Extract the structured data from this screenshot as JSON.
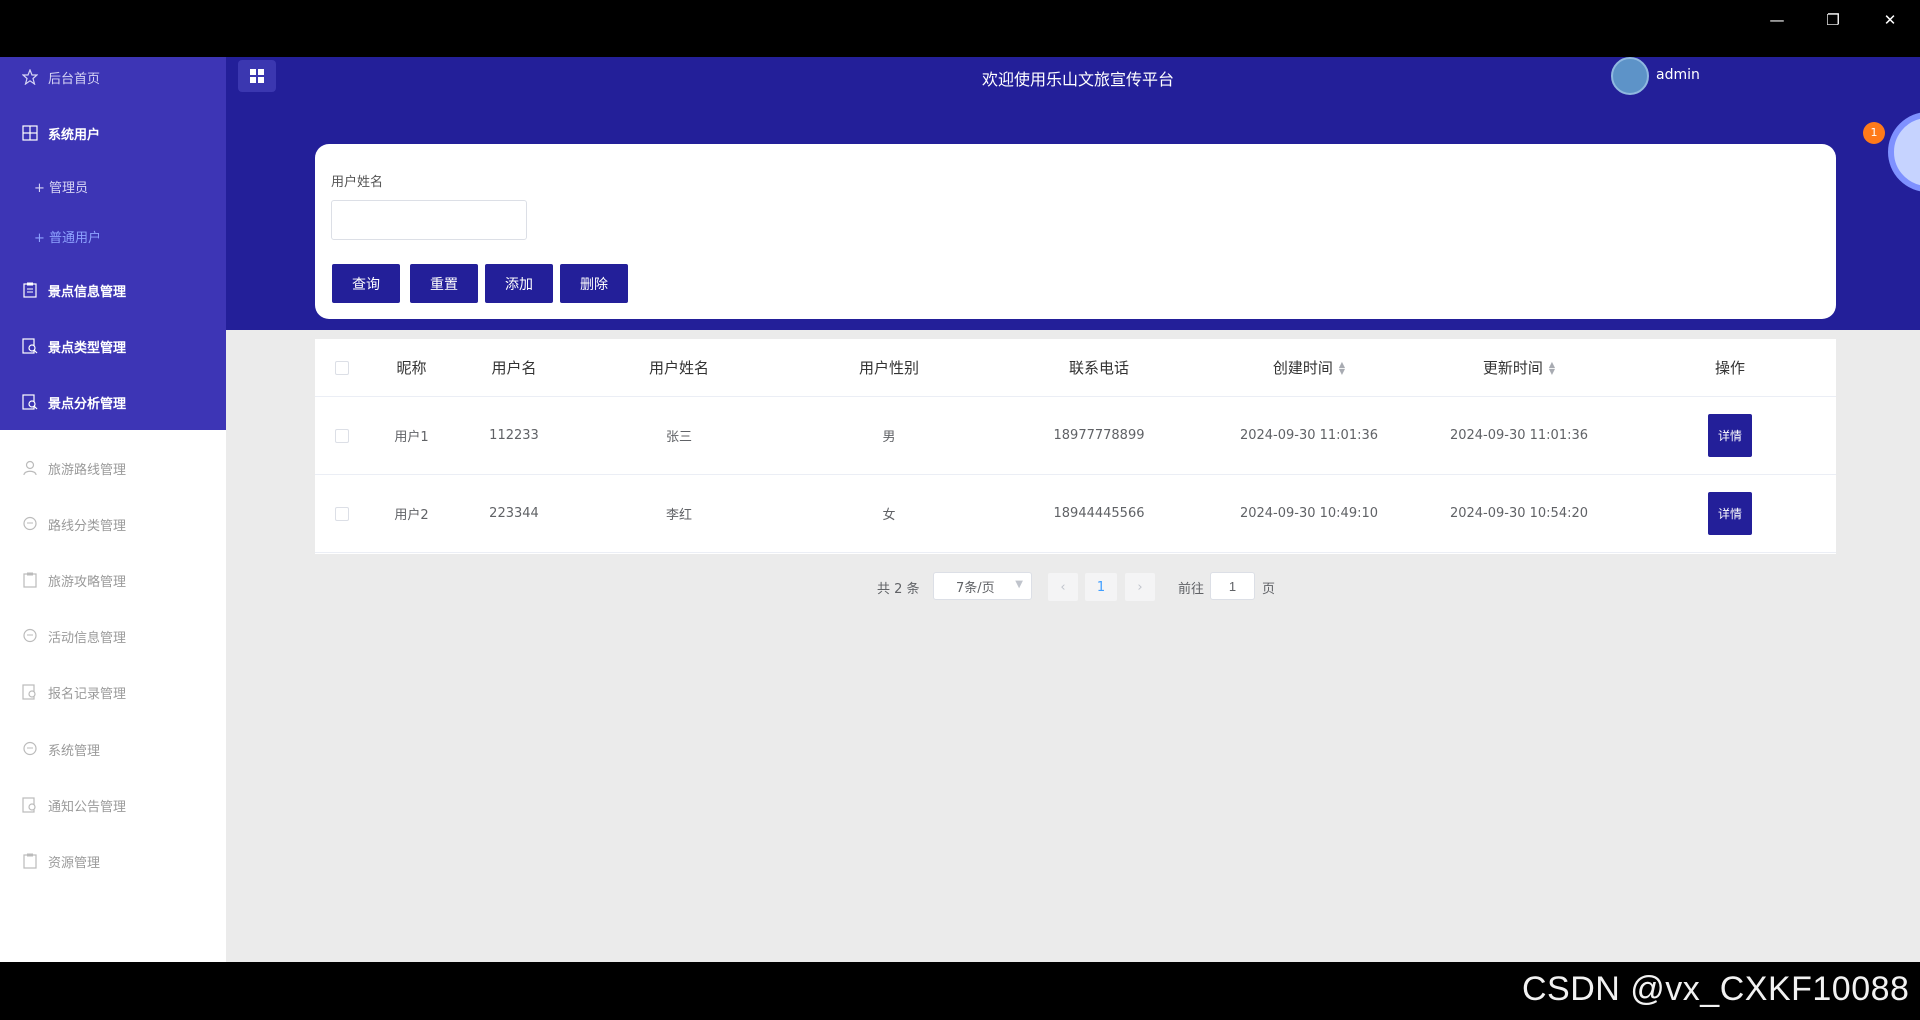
{
  "window": {
    "minimize": "—",
    "restore": "❐",
    "close": "✕"
  },
  "header": {
    "title": "欢迎使用乐山文旅宣传平台",
    "user": "admin",
    "badge_count": "1"
  },
  "sidebar": {
    "items": [
      {
        "label": "后台首页",
        "icon": "star-icon"
      },
      {
        "label": "系统用户",
        "icon": "grid-icon"
      },
      {
        "label": "景点信息管理",
        "icon": "clipboard-icon"
      },
      {
        "label": "景点类型管理",
        "icon": "document-search-icon"
      },
      {
        "label": "景点分析管理",
        "icon": "document-search-icon"
      },
      {
        "label": "旅游路线管理",
        "icon": "user-icon"
      },
      {
        "label": "路线分类管理",
        "icon": "chat-icon"
      },
      {
        "label": "旅游攻略管理",
        "icon": "clipboard-icon"
      },
      {
        "label": "活动信息管理",
        "icon": "chat-icon"
      },
      {
        "label": "报名记录管理",
        "icon": "document-search-icon"
      },
      {
        "label": "系统管理",
        "icon": "chat-icon"
      },
      {
        "label": "通知公告管理",
        "icon": "document-search-icon"
      },
      {
        "label": "资源管理",
        "icon": "clipboard-icon"
      }
    ],
    "subitems": [
      {
        "label": "+ 管理员"
      },
      {
        "label": "+ 普通用户"
      }
    ]
  },
  "search": {
    "label": "用户姓名",
    "value": "",
    "buttons": {
      "query": "查询",
      "reset": "重置",
      "add": "添加",
      "delete": "删除"
    }
  },
  "table": {
    "columns": [
      "昵称",
      "用户名",
      "用户姓名",
      "用户性别",
      "联系电话",
      "创建时间",
      "更新时间",
      "操作"
    ],
    "rows": [
      {
        "nickname": "用户1",
        "username": "112233",
        "name": "张三",
        "gender": "男",
        "phone": "18977778899",
        "created": "2024-09-30 11:01:36",
        "updated": "2024-09-30 11:01:36",
        "action": "详情"
      },
      {
        "nickname": "用户2",
        "username": "223344",
        "name": "李红",
        "gender": "女",
        "phone": "18944445566",
        "created": "2024-09-30 10:49:10",
        "updated": "2024-09-30 10:54:20",
        "action": "详情"
      }
    ]
  },
  "pagination": {
    "total": "共 2 条",
    "page_size": "7条/页",
    "current_page": "1",
    "goto_prefix": "前往",
    "goto_value": "1",
    "goto_suffix": "页",
    "prev": "‹",
    "next": "›"
  },
  "watermark": "CSDN @vx_CXKF10088",
  "colors": {
    "primary": "#231f99",
    "sidebar_active": "#3d35b5",
    "content_bg": "#ebebeb"
  }
}
